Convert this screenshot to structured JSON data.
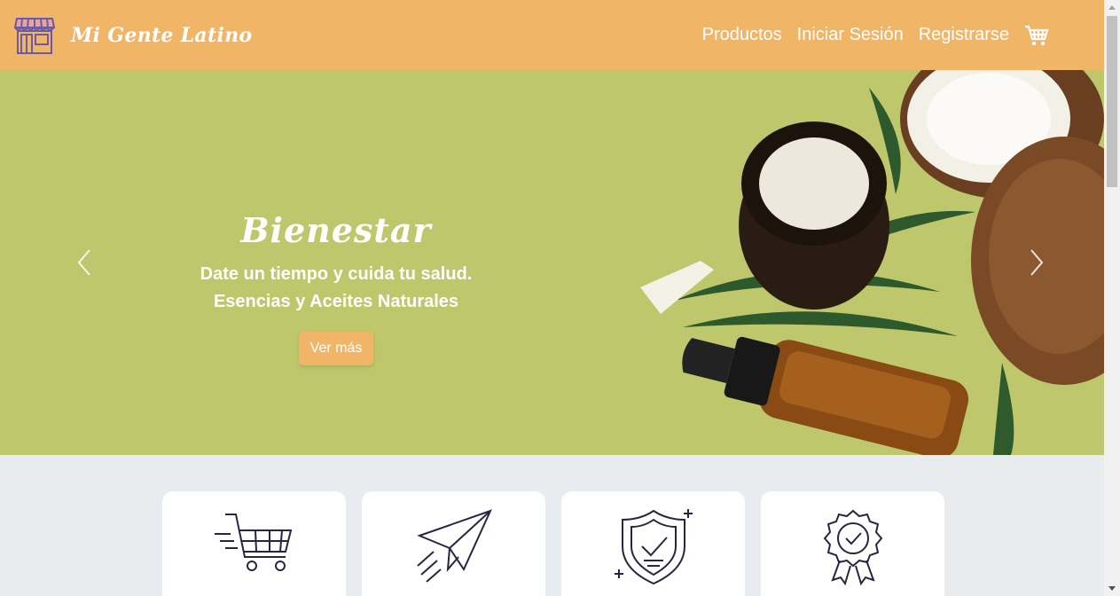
{
  "brand": {
    "name": "Mi Gente Latino",
    "icon": "storefront-icon"
  },
  "nav": {
    "items": [
      {
        "label": "Productos"
      },
      {
        "label": "Iniciar Sesión"
      },
      {
        "label": "Registrarse"
      }
    ],
    "cart_icon": "shopping-cart-icon"
  },
  "hero": {
    "title": "Bienestar",
    "line1": "Date un tiempo y cuida tu salud.",
    "line2": "Esencias y Aceites Naturales",
    "button_label": "Ver más",
    "prev_icon": "chevron-left-icon",
    "next_icon": "chevron-right-icon"
  },
  "features": [
    {
      "icon": "fast-cart-icon"
    },
    {
      "icon": "paper-plane-icon"
    },
    {
      "icon": "shield-check-icon"
    },
    {
      "icon": "quality-badge-icon"
    }
  ],
  "colors": {
    "accent": "#f1b567",
    "hero_bg": "#bfc76d",
    "page_bg": "#e9ecef",
    "icon_stroke": "#2b2440"
  }
}
